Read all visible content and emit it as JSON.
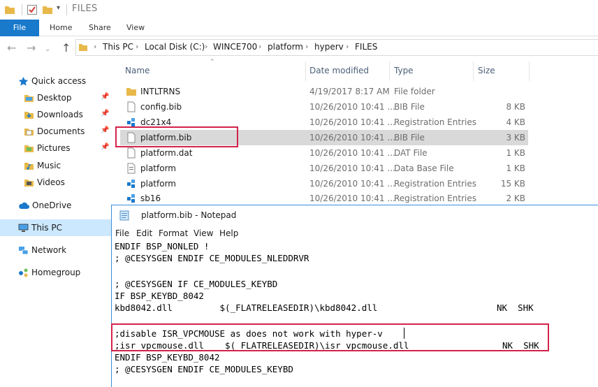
{
  "window": {
    "title": "FILES"
  },
  "ribbon": {
    "tabs": [
      "File",
      "Home",
      "Share",
      "View"
    ]
  },
  "breadcrumb": [
    "This PC",
    "Local Disk (C:)",
    "WINCE700",
    "platform",
    "hyperv",
    "FILES"
  ],
  "sidebar": {
    "items": [
      {
        "label": "Quick access",
        "icon": "star-icon",
        "pinned": false
      },
      {
        "label": "Desktop",
        "icon": "folder-desktop-icon",
        "pinned": true
      },
      {
        "label": "Downloads",
        "icon": "downloads-icon",
        "pinned": true
      },
      {
        "label": "Documents",
        "icon": "documents-icon",
        "pinned": true
      },
      {
        "label": "Pictures",
        "icon": "pictures-icon",
        "pinned": true
      },
      {
        "label": "Music",
        "icon": "music-icon",
        "pinned": false
      },
      {
        "label": "Videos",
        "icon": "videos-icon",
        "pinned": false
      },
      {
        "label": "OneDrive",
        "icon": "cloud-icon",
        "pinned": false
      },
      {
        "label": "This PC",
        "icon": "pc-icon",
        "pinned": false
      },
      {
        "label": "Network",
        "icon": "network-icon",
        "pinned": false
      },
      {
        "label": "Homegroup",
        "icon": "homegroup-icon",
        "pinned": false
      }
    ]
  },
  "columns": {
    "name": "Name",
    "date": "Date modified",
    "type": "Type",
    "size": "Size"
  },
  "files": [
    {
      "name": "INTLTRNS",
      "date": "4/19/2017 8:17 AM",
      "type": "File folder",
      "size": "",
      "icon": "folder-icon"
    },
    {
      "name": "config.bib",
      "date": "10/26/2010 10:41 ...",
      "type": "BIB File",
      "size": "8 KB",
      "icon": "file-icon"
    },
    {
      "name": "dc21x4",
      "date": "10/26/2010 10:41 ...",
      "type": "Registration Entries",
      "size": "4 KB",
      "icon": "registry-icon"
    },
    {
      "name": "platform.bib",
      "date": "10/26/2010 10:41 ...",
      "type": "BIB File",
      "size": "3 KB",
      "icon": "file-icon"
    },
    {
      "name": "platform.dat",
      "date": "10/26/2010 10:41 ...",
      "type": "DAT File",
      "size": "1 KB",
      "icon": "file-icon"
    },
    {
      "name": "platform",
      "date": "10/26/2010 10:41 ...",
      "type": "Data Base File",
      "size": "1 KB",
      "icon": "database-file-icon"
    },
    {
      "name": "platform",
      "date": "10/26/2010 10:41 ...",
      "type": "Registration Entries",
      "size": "15 KB",
      "icon": "registry-icon"
    },
    {
      "name": "sb16",
      "date": "10/26/2010 10:41 ...",
      "type": "Registration Entries",
      "size": "2 KB",
      "icon": "registry-icon"
    }
  ],
  "notepad": {
    "title": "platform.bib - Notepad",
    "menu": [
      "File",
      "Edit",
      "Format",
      "View",
      "Help"
    ],
    "lines": [
      {
        "text": "ENDIF BSP_NONLED !",
        "flags": ""
      },
      {
        "text": "; @CESYSGEN ENDIF CE_MODULES_NLEDDRVR",
        "flags": ""
      },
      {
        "text": "",
        "flags": ""
      },
      {
        "text": "; @CESYSGEN IF CE_MODULES_KEYBD",
        "flags": ""
      },
      {
        "text": "IF BSP_KEYBD_8042",
        "flags": ""
      },
      {
        "text": "kbd8042.dll         $(_FLATRELEASEDIR)\\kbd8042.dll",
        "flags": "NK  SHK"
      },
      {
        "text": "",
        "flags": ""
      },
      {
        "text": ";disable ISR_VPCMOUSE as does not work with hyper-v",
        "flags": ""
      },
      {
        "text": ";isr_vpcmouse.dll    $(_FLATRELEASEDIR)\\isr_vpcmouse.dll",
        "flags": "NK  SHK"
      },
      {
        "text": "ENDIF BSP_KEYBD_8042",
        "flags": ""
      },
      {
        "text": "; @CESYSGEN ENDIF CE_MODULES_KEYBD",
        "flags": ""
      }
    ]
  },
  "colors": {
    "accent": "#1979ca",
    "highlight": "#d3234a",
    "selection": "#cce8ff",
    "row_selected": "#d9d9d9",
    "folder": "#e8b94a"
  }
}
